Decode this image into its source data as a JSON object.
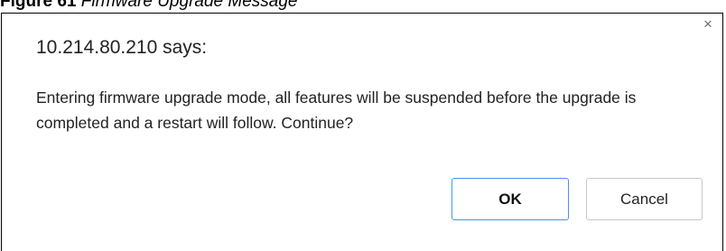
{
  "caption": {
    "number": "Figure 61",
    "title": "Firmware Upgrade Message"
  },
  "dialog": {
    "title": "10.214.80.210 says:",
    "message": "Entering firmware upgrade mode, all features will be suspended before the upgrade is completed and a restart will follow. Continue?",
    "close_glyph": "×",
    "ok_label": "OK",
    "cancel_label": "Cancel"
  },
  "colors": {
    "ok_border": "#4d90fe",
    "cancel_border": "#c8c8c8"
  }
}
